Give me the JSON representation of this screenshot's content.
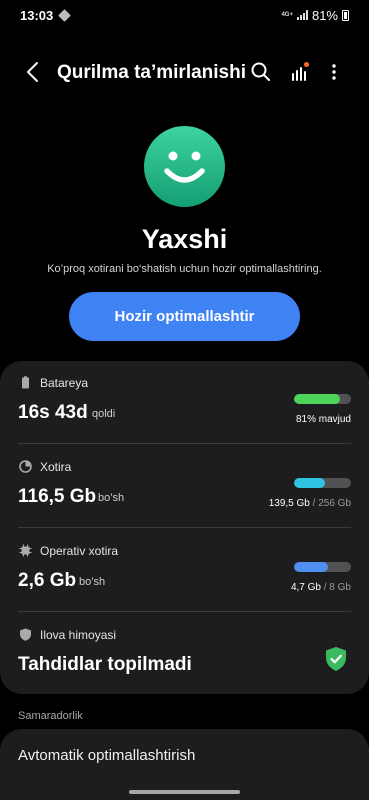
{
  "status_bar": {
    "time": "13:03",
    "network": "4G+",
    "battery_pct": "81%"
  },
  "header": {
    "title": "Qurilma ta’mirlanishi"
  },
  "icons": {
    "back": "back-arrow-icon",
    "search": "search-icon",
    "stats": "stats-icon",
    "more": "more-vert-icon"
  },
  "hero": {
    "status": "Yaxshi",
    "hint": "Ko’proq xotirani bo‘shatish uchun hozir optimallashtiring.",
    "button": "Hozir optimallashtir"
  },
  "battery": {
    "label": "Batareya",
    "value": "16s 43d",
    "unit": "qoldi",
    "detail": "81% mavjud",
    "level": 81,
    "color": "#4fd45a"
  },
  "storage": {
    "label": "Xotira",
    "value": "116,5 Gb",
    "unit": "bo’sh",
    "used": "139,5 Gb",
    "total": "/ 256 Gb",
    "level": 54,
    "color": "#2ec3e0"
  },
  "ram": {
    "label": "Operativ xotira",
    "value": "2,6 Gb",
    "unit": "bo’sh",
    "used": "4,7 Gb",
    "total": "/ 8 Gb",
    "level": 59,
    "color": "#4f8ff4"
  },
  "protection": {
    "label": "Ilova himoyasi",
    "value": "Tahdidlar topilmadi",
    "shield_color": "#3cb960"
  },
  "section": {
    "title": "Samaradorlik"
  },
  "auto_opt": {
    "label": "Avtomatik optimallashtirish"
  }
}
